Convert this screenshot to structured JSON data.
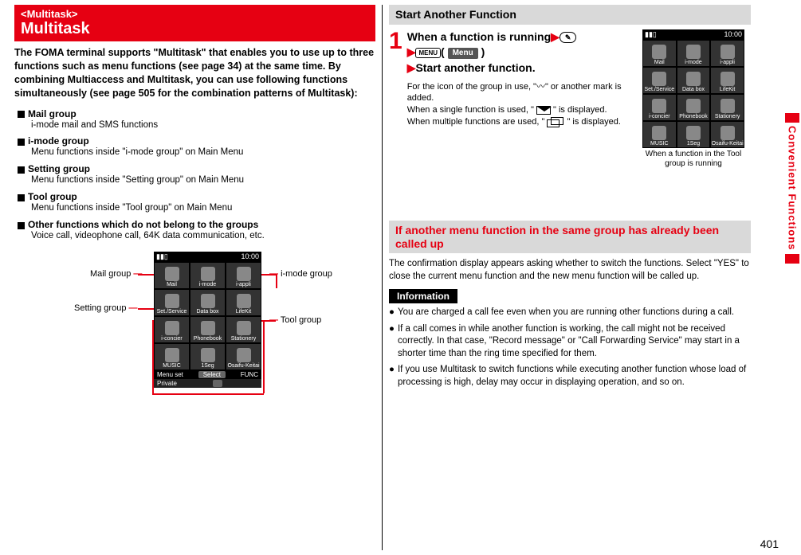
{
  "side_tab": "Convenient Functions",
  "page_number": "401",
  "left": {
    "tag": "<Multitask>",
    "title": "Multitask",
    "intro": "The FOMA terminal supports \"Multitask\" that enables you to use up to three functions such as menu functions (see page 34) at the same time. By combining Multiaccess and Multitask, you can use following functions simultaneously (see page 505 for the combination patterns of Multitask):",
    "groups": [
      {
        "title": "Mail group",
        "desc": "i-mode mail and SMS functions"
      },
      {
        "title": "i-mode group",
        "desc": "Menu functions inside \"i-mode group\" on Main Menu"
      },
      {
        "title": "Setting group",
        "desc": "Menu functions inside \"Setting group\" on Main Menu"
      },
      {
        "title": "Tool group",
        "desc": "Menu functions inside \"Tool group\" on Main Menu"
      },
      {
        "title": "Other functions which do not belong to the groups",
        "desc": "Voice call, videophone call, 64K data communication, etc."
      }
    ],
    "diagram": {
      "labels": {
        "mail": "Mail group",
        "setting": "Setting group",
        "imode": "i-mode group",
        "tool": "Tool group"
      },
      "status_time": "10:00",
      "cells": [
        "Mail",
        "i-mode",
        "i-appli",
        "Set./Service",
        "Data box",
        "LifeKit",
        "i-concier",
        "Phonebook",
        "Stationery",
        "MUSIC",
        "1Seg",
        "Osaifu-Keitai"
      ],
      "soft_left": "Menu set",
      "soft_mid": "Select",
      "soft_right": "FUNC",
      "soft_sub": "Private"
    }
  },
  "right": {
    "start_h": "Start Another Function",
    "step1_num": "1",
    "step1_line1a": "When a function is running",
    "step1_line1_pen": "✎",
    "step1_line2_menu": "MENU",
    "step1_line2_label": "Menu",
    "step1_line3": "Start another function.",
    "step1_note1": "For the icon of the group in use, \"",
    "step1_note1b": "\" or another mark is added.",
    "step1_note2a": "When a single function is used, \" ",
    "step1_note2b": " \" is displayed.",
    "step1_note3a": "When multiple functions are used, \" ",
    "step1_note3b": " \" is displayed.",
    "phone_caption": "When a function in the Tool group is running",
    "same_group_h": "If another menu function in the same group has already been called up",
    "same_group_p": "The confirmation display appears asking whether to switch the functions. Select \"YES\" to close the current menu function and the new menu function will be called up.",
    "info_h": "Information",
    "info": [
      "You are charged a call fee even when you are running other functions during a call.",
      "If a call comes in while another function is working, the call might not be received correctly. In that case, \"Record message\" or \"Call Forwarding Service\" may start in a shorter time than the ring time specified for them.",
      "If you use Multitask to switch functions while executing another function whose load of processing is high, delay may occur in displaying operation, and so on."
    ],
    "phone": {
      "status_time": "10:00",
      "cells": [
        "Mail",
        "i-mode",
        "i-appli",
        "Set./Service",
        "Data box",
        "LifeKit",
        "i-concier",
        "Phonebook",
        "Stationery",
        "MUSIC",
        "1Seg",
        "Osaifu-Keitai"
      ]
    }
  }
}
